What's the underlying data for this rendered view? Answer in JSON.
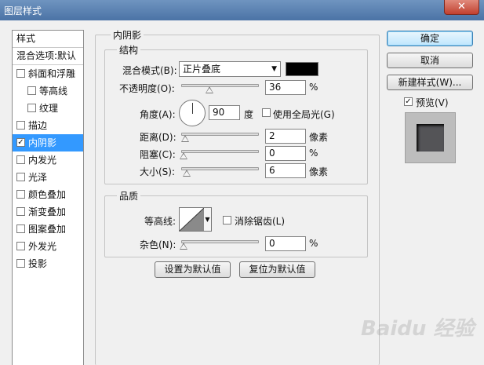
{
  "window": {
    "title": "图层样式",
    "close_glyph": "✕"
  },
  "sidebar": {
    "header": "样式",
    "blend_options": "混合选项:默认",
    "items": [
      {
        "label": "斜面和浮雕",
        "checked": false,
        "sub": false,
        "selected": false
      },
      {
        "label": "等高线",
        "checked": false,
        "sub": true,
        "selected": false
      },
      {
        "label": "纹理",
        "checked": false,
        "sub": true,
        "selected": false
      },
      {
        "label": "描边",
        "checked": false,
        "sub": false,
        "selected": false
      },
      {
        "label": "内阴影",
        "checked": true,
        "sub": false,
        "selected": true
      },
      {
        "label": "内发光",
        "checked": false,
        "sub": false,
        "selected": false
      },
      {
        "label": "光泽",
        "checked": false,
        "sub": false,
        "selected": false
      },
      {
        "label": "颜色叠加",
        "checked": false,
        "sub": false,
        "selected": false
      },
      {
        "label": "渐变叠加",
        "checked": false,
        "sub": false,
        "selected": false
      },
      {
        "label": "图案叠加",
        "checked": false,
        "sub": false,
        "selected": false
      },
      {
        "label": "外发光",
        "checked": false,
        "sub": false,
        "selected": false
      },
      {
        "label": "投影",
        "checked": false,
        "sub": false,
        "selected": false
      }
    ]
  },
  "panel": {
    "title": "内阴影",
    "structure": {
      "title": "结构",
      "blend_mode_label": "混合模式(B):",
      "blend_mode_value": "正片叠底",
      "shadow_color": "#000000",
      "opacity_label": "不透明度(O):",
      "opacity_value": "36",
      "opacity_unit": "%",
      "angle_label": "角度(A):",
      "angle_value": "90",
      "angle_unit": "度",
      "global_light_label": "使用全局光(G)",
      "distance_label": "距离(D):",
      "distance_value": "2",
      "distance_unit": "像素",
      "choke_label": "阻塞(C):",
      "choke_value": "0",
      "choke_unit": "%",
      "size_label": "大小(S):",
      "size_value": "6",
      "size_unit": "像素"
    },
    "quality": {
      "title": "品质",
      "contour_label": "等高线:",
      "antialias_label": "消除锯齿(L)",
      "noise_label": "杂色(N):",
      "noise_value": "0",
      "noise_unit": "%"
    },
    "make_default": "设置为默认值",
    "reset_default": "复位为默认值"
  },
  "buttons": {
    "ok": "确定",
    "cancel": "取消",
    "new_style": "新建样式(W)...",
    "preview_label": "预览(V)"
  },
  "watermark": "Baidu 经验"
}
